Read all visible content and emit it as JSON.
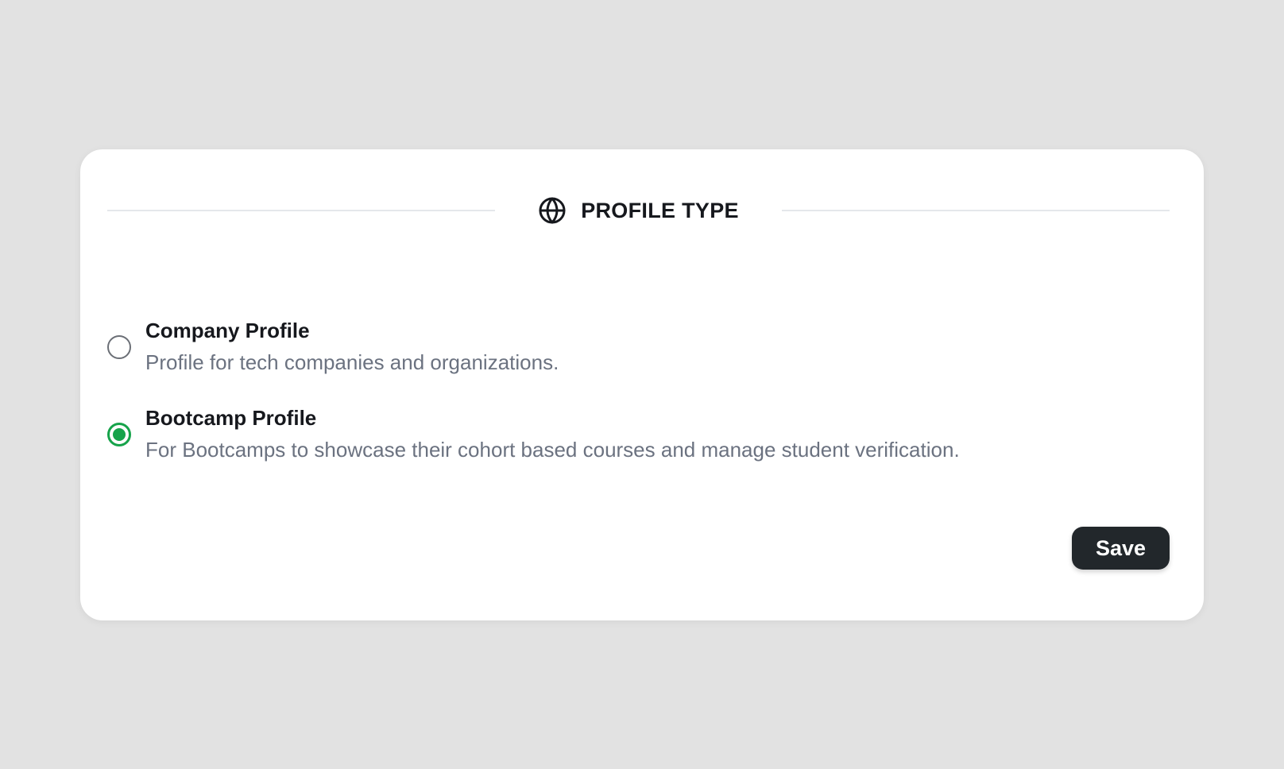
{
  "section": {
    "title": "PROFILE TYPE",
    "icon": "globe-icon"
  },
  "options": [
    {
      "label": "Company Profile",
      "description": "Profile for tech companies and organizations.",
      "selected": false
    },
    {
      "label": "Bootcamp Profile",
      "description": "For Bootcamps to showcase their cohort based courses and manage student verification.",
      "selected": true
    }
  ],
  "actions": {
    "save_label": "Save"
  },
  "colors": {
    "accent": "#16a34a",
    "button_bg": "#22272b",
    "background": "#e2e2e2",
    "muted_text": "#6b7280"
  }
}
